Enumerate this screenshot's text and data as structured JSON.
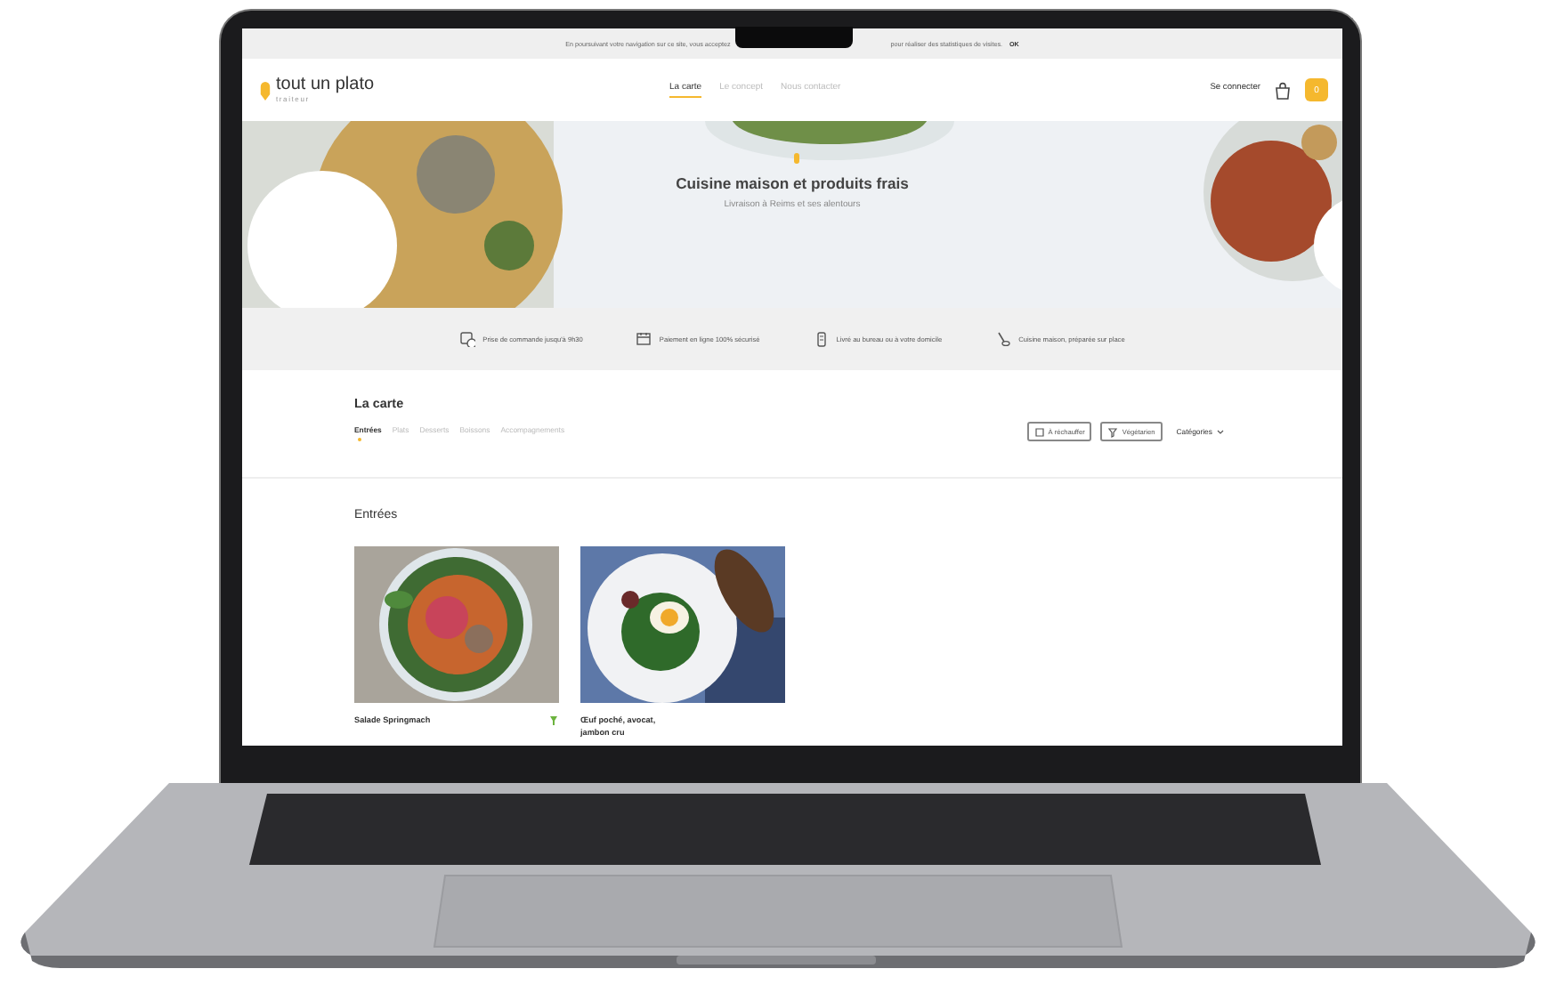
{
  "cookie_banner": {
    "text_left": "En poursuivant votre navigation sur ce site, vous acceptez",
    "text_right": "pour réaliser des statistiques de visites.",
    "button": "OK"
  },
  "header": {
    "logo": "tout un plato",
    "tagline": "traiteur",
    "nav": [
      {
        "label": "La carte",
        "selected": true
      },
      {
        "label": "Le concept",
        "selected": false
      },
      {
        "label": "Nous contacter",
        "selected": false
      }
    ],
    "login": "Se connecter",
    "cart_count": "0"
  },
  "hero": {
    "title": "Cuisine maison et produits frais",
    "subtitle": "Livraison à Reims et ses alentours"
  },
  "features": [
    "Prise de commande jusqu'à 9h30",
    "Paiement en ligne 100% sécurisé",
    "Livré au bureau ou à votre domicile",
    "Cuisine maison, préparée sur place"
  ],
  "menu": {
    "title": "La carte",
    "tabs": [
      {
        "label": "Entrées",
        "selected": true
      },
      {
        "label": "Plats",
        "selected": false
      },
      {
        "label": "Desserts",
        "selected": false
      },
      {
        "label": "Boissons",
        "selected": false
      },
      {
        "label": "Accompagnements",
        "selected": false
      }
    ],
    "filters": [
      "À réchauffer",
      "Végétarien"
    ],
    "categories": "Catégories"
  },
  "section": {
    "title": "Entrées",
    "dishes": [
      {
        "name": "Salade Springmach",
        "vegetarian": true
      },
      {
        "name": "Œuf poché, avocat, jambon cru",
        "vegetarian": false
      }
    ]
  }
}
